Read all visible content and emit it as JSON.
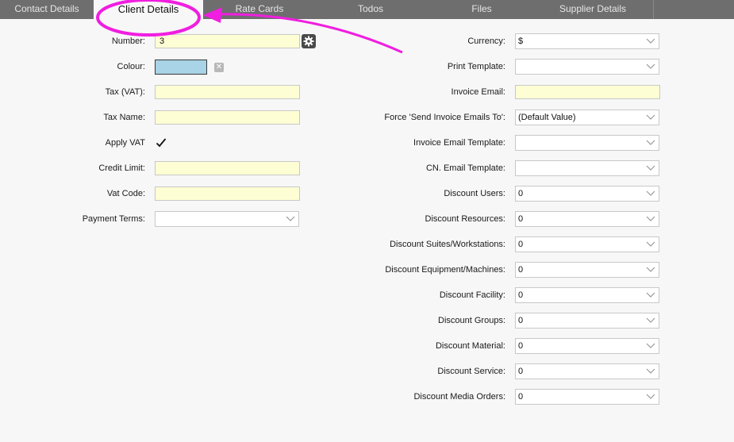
{
  "tabs": [
    {
      "label": "Contact Details"
    },
    {
      "label": "Client Details"
    },
    {
      "label": "Rate Cards"
    },
    {
      "label": "Todos"
    },
    {
      "label": "Files"
    },
    {
      "label": "Supplier Details"
    }
  ],
  "left": {
    "number": {
      "label": "Number:",
      "value": "3"
    },
    "colour": {
      "label": "Colour:",
      "swatch": "#a9d3e6"
    },
    "tax_vat": {
      "label": "Tax (VAT):",
      "value": ""
    },
    "tax_name": {
      "label": "Tax Name:",
      "value": ""
    },
    "apply_vat": {
      "label": "Apply VAT",
      "checked": true
    },
    "credit_limit": {
      "label": "Credit Limit:",
      "value": ""
    },
    "vat_code": {
      "label": "Vat Code:",
      "value": ""
    },
    "payment_terms": {
      "label": "Payment Terms:",
      "value": ""
    }
  },
  "right": {
    "currency": {
      "label": "Currency:",
      "value": "$"
    },
    "print_template": {
      "label": "Print Template:",
      "value": ""
    },
    "invoice_email": {
      "label": "Invoice Email:",
      "value": ""
    },
    "force_send": {
      "label": "Force 'Send Invoice Emails To':",
      "value": "(Default Value)"
    },
    "invoice_email_template": {
      "label": "Invoice Email Template:",
      "value": ""
    },
    "cn_email_template": {
      "label": "CN. Email Template:",
      "value": ""
    },
    "discounts": [
      {
        "label": "Discount Users:",
        "value": "0"
      },
      {
        "label": "Discount Resources:",
        "value": "0"
      },
      {
        "label": "Discount Suites/Workstations:",
        "value": "0"
      },
      {
        "label": "Discount Equipment/Machines:",
        "value": "0"
      },
      {
        "label": "Discount Facility:",
        "value": "0"
      },
      {
        "label": "Discount Groups:",
        "value": "0"
      },
      {
        "label": "Discount Material:",
        "value": "0"
      },
      {
        "label": "Discount Service:",
        "value": "0"
      },
      {
        "label": "Discount Media Orders:",
        "value": "0"
      }
    ]
  },
  "colors": {
    "annotation": "#f01ee0",
    "input_bg": "#fefed4",
    "tab_bg": "#6e6e6e"
  }
}
